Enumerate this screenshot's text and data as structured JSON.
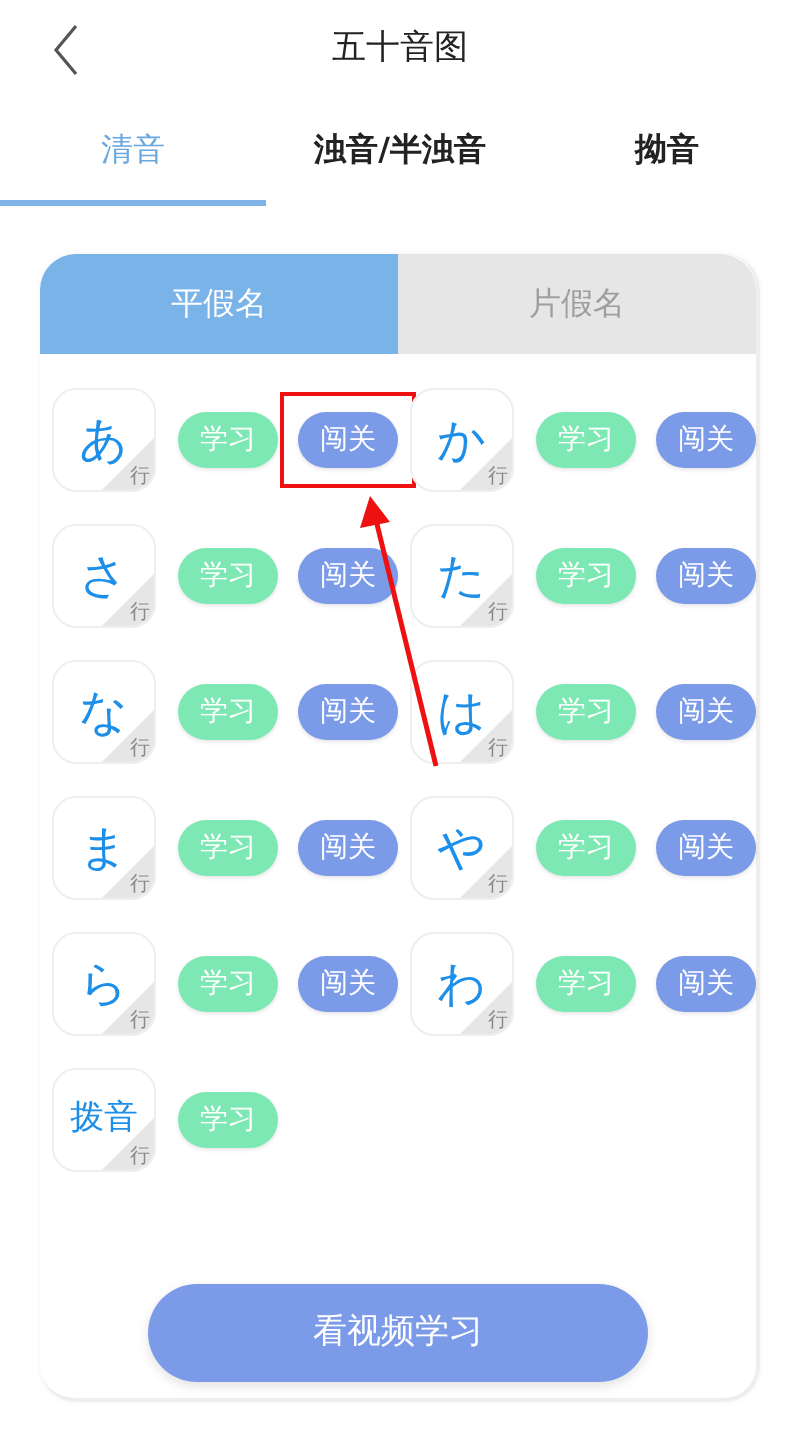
{
  "header": {
    "title": "五十音图"
  },
  "tabs": [
    {
      "label": "清音",
      "selected": true
    },
    {
      "label": "浊音/半浊音",
      "selected": false
    },
    {
      "label": "拗音",
      "selected": false
    }
  ],
  "segments": [
    {
      "label": "平假名",
      "selected": true
    },
    {
      "label": "片假名",
      "selected": false
    }
  ],
  "kana": [
    {
      "label": "あ",
      "corner": "行",
      "actions": [
        {
          "kind": "learn",
          "label": "学习",
          "highlighted": false
        },
        {
          "kind": "challenge",
          "label": "闯关",
          "highlighted": true
        }
      ]
    },
    {
      "label": "か",
      "corner": "行",
      "actions": [
        {
          "kind": "learn",
          "label": "学习",
          "highlighted": false
        },
        {
          "kind": "challenge",
          "label": "闯关",
          "highlighted": false
        }
      ]
    },
    {
      "label": "さ",
      "corner": "行",
      "actions": [
        {
          "kind": "learn",
          "label": "学习",
          "highlighted": false
        },
        {
          "kind": "challenge",
          "label": "闯关",
          "highlighted": false
        }
      ]
    },
    {
      "label": "た",
      "corner": "行",
      "actions": [
        {
          "kind": "learn",
          "label": "学习",
          "highlighted": false
        },
        {
          "kind": "challenge",
          "label": "闯关",
          "highlighted": false
        }
      ]
    },
    {
      "label": "な",
      "corner": "行",
      "actions": [
        {
          "kind": "learn",
          "label": "学习",
          "highlighted": false
        },
        {
          "kind": "challenge",
          "label": "闯关",
          "highlighted": false
        }
      ]
    },
    {
      "label": "は",
      "corner": "行",
      "actions": [
        {
          "kind": "learn",
          "label": "学习",
          "highlighted": false
        },
        {
          "kind": "challenge",
          "label": "闯关",
          "highlighted": false
        }
      ]
    },
    {
      "label": "ま",
      "corner": "行",
      "actions": [
        {
          "kind": "learn",
          "label": "学习",
          "highlighted": false
        },
        {
          "kind": "challenge",
          "label": "闯关",
          "highlighted": false
        }
      ]
    },
    {
      "label": "や",
      "corner": "行",
      "actions": [
        {
          "kind": "learn",
          "label": "学习",
          "highlighted": false
        },
        {
          "kind": "challenge",
          "label": "闯关",
          "highlighted": false
        }
      ]
    },
    {
      "label": "ら",
      "corner": "行",
      "actions": [
        {
          "kind": "learn",
          "label": "学习",
          "highlighted": false
        },
        {
          "kind": "challenge",
          "label": "闯关",
          "highlighted": false
        }
      ]
    },
    {
      "label": "わ",
      "corner": "行",
      "actions": [
        {
          "kind": "learn",
          "label": "学习",
          "highlighted": false
        },
        {
          "kind": "challenge",
          "label": "闯关",
          "highlighted": false
        }
      ]
    },
    {
      "label": "拨音",
      "corner": "行",
      "actions": [
        {
          "kind": "learn",
          "label": "学习",
          "highlighted": false
        }
      ]
    }
  ],
  "video_button": "看视频学习"
}
